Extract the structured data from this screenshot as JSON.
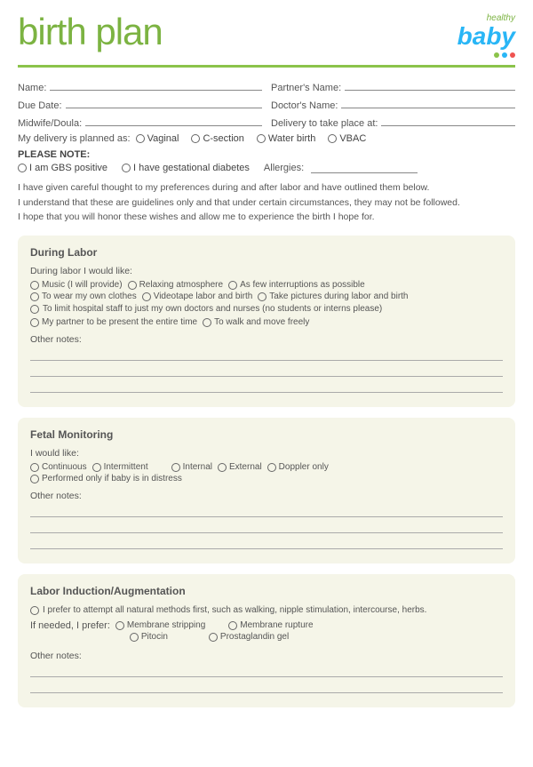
{
  "header": {
    "title": "birth plan",
    "logo_healthy": "healthy",
    "logo_baby": "baby",
    "dots": [
      "#8bc34a",
      "#29b6f6",
      "#ef5350"
    ]
  },
  "form": {
    "name_label": "Name:",
    "partners_name_label": "Partner's Name:",
    "due_date_label": "Due Date:",
    "doctors_name_label": "Doctor's Name:",
    "midwife_label": "Midwife/Doula:",
    "delivery_place_label": "Delivery to take place at:",
    "delivery_planned_label": "My delivery is planned as:",
    "delivery_options": [
      "Vaginal",
      "C-section",
      "Water birth",
      "VBAC"
    ]
  },
  "please_note": {
    "title": "PLEASE NOTE:",
    "options": [
      "I am GBS positive",
      "I have gestational diabetes"
    ],
    "allergies_label": "Allergies:"
  },
  "intro": {
    "line1": "I have given careful thought to my preferences during and after labor and have outlined them below.",
    "line2": "I understand that these are guidelines only and that under certain circumstances, they may not be followed.",
    "line3": "I hope that you will honor these wishes and allow me to experience the birth I hope for."
  },
  "during_labor": {
    "title": "During Labor",
    "subtitle": "During labor I would like:",
    "options_row1": [
      "Music (I will provide)",
      "Relaxing atmosphere",
      "As few interruptions as possible"
    ],
    "options_row2": [
      "To wear my own clothes",
      "Videotape labor and birth",
      "Take pictures during labor and birth"
    ],
    "options_row3": [
      "To limit hospital staff to just my own doctors and nurses (no students or interns please)"
    ],
    "options_row4": [
      "My partner to be present the entire time",
      "To walk and move freely"
    ],
    "other_notes_label": "Other notes:"
  },
  "fetal_monitoring": {
    "title": "Fetal Monitoring",
    "subtitle": "I would like:",
    "options_row1": [
      "Continuous",
      "Intermittent",
      "Internal",
      "External",
      "Doppler only"
    ],
    "options_row2": [
      "Performed only if baby is in distress"
    ],
    "other_notes_label": "Other notes:"
  },
  "labor_induction": {
    "title": "Labor Induction/Augmentation",
    "natural_text": "I prefer to attempt all natural methods first, such as walking, nipple stimulation, intercourse, herbs.",
    "if_needed_label": "If needed, I prefer:",
    "options": [
      [
        "Membrane stripping",
        "Membrane rupture"
      ],
      [
        "Pitocin",
        "Prostaglandin gel"
      ]
    ],
    "other_notes_label": "Other notes:"
  }
}
